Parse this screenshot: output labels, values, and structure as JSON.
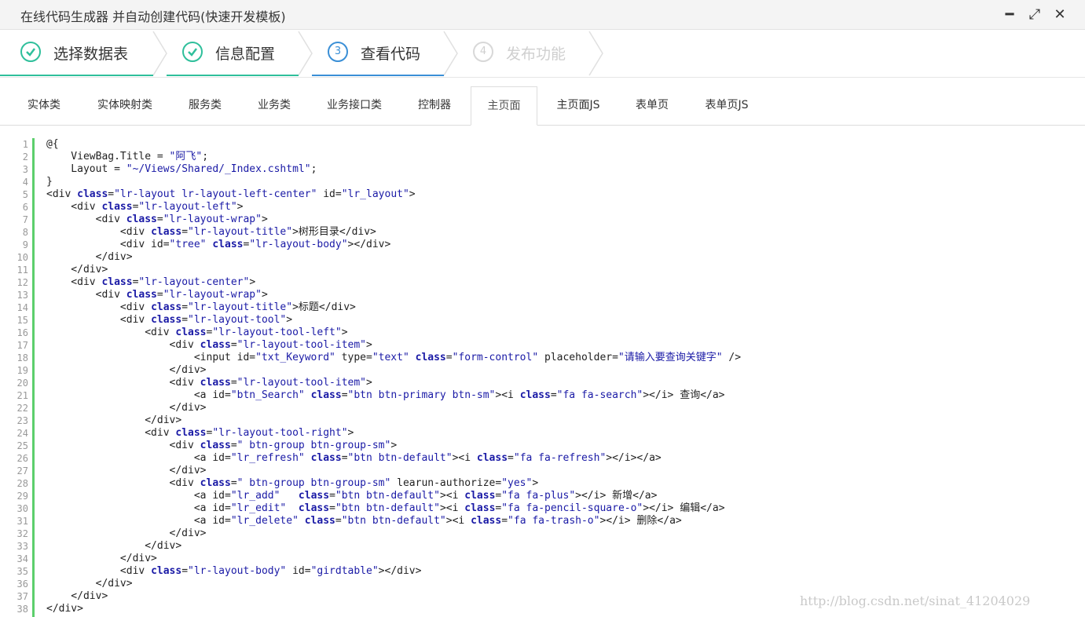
{
  "window": {
    "title": "在线代码生成器 并自动创建代码(快速开发模板)",
    "controls": {
      "minimize": "━",
      "maximize": "⤢",
      "close": "✕"
    }
  },
  "steps": [
    {
      "label": "选择数据表",
      "state": "done",
      "mark": "✓"
    },
    {
      "label": "信息配置",
      "state": "done",
      "mark": "✓"
    },
    {
      "label": "查看代码",
      "state": "current",
      "mark": "3"
    },
    {
      "label": "发布功能",
      "state": "future",
      "mark": "4"
    }
  ],
  "tabs": [
    {
      "label": "实体类"
    },
    {
      "label": "实体映射类"
    },
    {
      "label": "服务类"
    },
    {
      "label": "业务类"
    },
    {
      "label": "业务接口类"
    },
    {
      "label": "控制器"
    },
    {
      "label": "主页面",
      "active": true
    },
    {
      "label": "主页面JS"
    },
    {
      "label": "表单页"
    },
    {
      "label": "表单页JS"
    }
  ],
  "colors": {
    "kw": "#1a1aa6",
    "str": "#1a1aa6",
    "tag": "#222222",
    "success": "#2fbf9b",
    "current": "#3a8fd6",
    "gutterbar": "#5ccf6c"
  },
  "code": [
    [
      [
        "",
        "@{"
      ]
    ],
    [
      [
        "",
        "    ViewBag.Title = "
      ],
      [
        "s",
        "\"阿飞\""
      ],
      [
        "",
        ";"
      ]
    ],
    [
      [
        "",
        "    Layout = "
      ],
      [
        "s",
        "\"~/Views/Shared/_Index.cshtml\""
      ],
      [
        "",
        ";"
      ]
    ],
    [
      [
        "",
        "}"
      ]
    ],
    [
      [
        "",
        "<div "
      ],
      [
        "k",
        "class"
      ],
      [
        "",
        "="
      ],
      [
        "s",
        "\"lr-layout lr-layout-left-center\""
      ],
      [
        "",
        " id="
      ],
      [
        "s",
        "\"lr_layout\""
      ],
      [
        "",
        ">"
      ]
    ],
    [
      [
        "",
        "    <div "
      ],
      [
        "k",
        "class"
      ],
      [
        "",
        "="
      ],
      [
        "s",
        "\"lr-layout-left\""
      ],
      [
        "",
        ">"
      ]
    ],
    [
      [
        "",
        "        <div "
      ],
      [
        "k",
        "class"
      ],
      [
        "",
        "="
      ],
      [
        "s",
        "\"lr-layout-wrap\""
      ],
      [
        "",
        ">"
      ]
    ],
    [
      [
        "",
        "            <div "
      ],
      [
        "k",
        "class"
      ],
      [
        "",
        "="
      ],
      [
        "s",
        "\"lr-layout-title\""
      ],
      [
        "",
        ">树形目录</div>"
      ]
    ],
    [
      [
        "",
        "            <div id="
      ],
      [
        "s",
        "\"tree\""
      ],
      [
        "",
        " "
      ],
      [
        "k",
        "class"
      ],
      [
        "",
        "="
      ],
      [
        "s",
        "\"lr-layout-body\""
      ],
      [
        "",
        "></div>"
      ]
    ],
    [
      [
        "",
        "        </div>"
      ]
    ],
    [
      [
        "",
        "    </div>"
      ]
    ],
    [
      [
        "",
        "    <div "
      ],
      [
        "k",
        "class"
      ],
      [
        "",
        "="
      ],
      [
        "s",
        "\"lr-layout-center\""
      ],
      [
        "",
        ">"
      ]
    ],
    [
      [
        "",
        "        <div "
      ],
      [
        "k",
        "class"
      ],
      [
        "",
        "="
      ],
      [
        "s",
        "\"lr-layout-wrap\""
      ],
      [
        "",
        ">"
      ]
    ],
    [
      [
        "",
        "            <div "
      ],
      [
        "k",
        "class"
      ],
      [
        "",
        "="
      ],
      [
        "s",
        "\"lr-layout-title\""
      ],
      [
        "",
        ">标题</div>"
      ]
    ],
    [
      [
        "",
        "            <div "
      ],
      [
        "k",
        "class"
      ],
      [
        "",
        "="
      ],
      [
        "s",
        "\"lr-layout-tool\""
      ],
      [
        "",
        ">"
      ]
    ],
    [
      [
        "",
        "                <div "
      ],
      [
        "k",
        "class"
      ],
      [
        "",
        "="
      ],
      [
        "s",
        "\"lr-layout-tool-left\""
      ],
      [
        "",
        ">"
      ]
    ],
    [
      [
        "",
        "                    <div "
      ],
      [
        "k",
        "class"
      ],
      [
        "",
        "="
      ],
      [
        "s",
        "\"lr-layout-tool-item\""
      ],
      [
        "",
        ">"
      ]
    ],
    [
      [
        "",
        "                        <input id="
      ],
      [
        "s",
        "\"txt_Keyword\""
      ],
      [
        "",
        " type="
      ],
      [
        "s",
        "\"text\""
      ],
      [
        "",
        " "
      ],
      [
        "k",
        "class"
      ],
      [
        "",
        "="
      ],
      [
        "s",
        "\"form-control\""
      ],
      [
        "",
        " placeholder="
      ],
      [
        "s",
        "\"请输入要查询关键字\""
      ],
      [
        "",
        " />"
      ]
    ],
    [
      [
        "",
        "                    </div>"
      ]
    ],
    [
      [
        "",
        "                    <div "
      ],
      [
        "k",
        "class"
      ],
      [
        "",
        "="
      ],
      [
        "s",
        "\"lr-layout-tool-item\""
      ],
      [
        "",
        ">"
      ]
    ],
    [
      [
        "",
        "                        <a id="
      ],
      [
        "s",
        "\"btn_Search\""
      ],
      [
        "",
        " "
      ],
      [
        "k",
        "class"
      ],
      [
        "",
        "="
      ],
      [
        "s",
        "\"btn btn-primary btn-sm\""
      ],
      [
        "",
        "><i "
      ],
      [
        "k",
        "class"
      ],
      [
        "",
        "="
      ],
      [
        "s",
        "\"fa fa-search\""
      ],
      [
        "",
        "></i> 查询</a>"
      ]
    ],
    [
      [
        "",
        "                    </div>"
      ]
    ],
    [
      [
        "",
        "                </div>"
      ]
    ],
    [
      [
        "",
        "                <div "
      ],
      [
        "k",
        "class"
      ],
      [
        "",
        "="
      ],
      [
        "s",
        "\"lr-layout-tool-right\""
      ],
      [
        "",
        ">"
      ]
    ],
    [
      [
        "",
        "                    <div "
      ],
      [
        "k",
        "class"
      ],
      [
        "",
        "="
      ],
      [
        "s",
        "\" btn-group btn-group-sm\""
      ],
      [
        "",
        ">"
      ]
    ],
    [
      [
        "",
        "                        <a id="
      ],
      [
        "s",
        "\"lr_refresh\""
      ],
      [
        "",
        " "
      ],
      [
        "k",
        "class"
      ],
      [
        "",
        "="
      ],
      [
        "s",
        "\"btn btn-default\""
      ],
      [
        "",
        "><i "
      ],
      [
        "k",
        "class"
      ],
      [
        "",
        "="
      ],
      [
        "s",
        "\"fa fa-refresh\""
      ],
      [
        "",
        "></i></a>"
      ]
    ],
    [
      [
        "",
        "                    </div>"
      ]
    ],
    [
      [
        "",
        "                    <div "
      ],
      [
        "k",
        "class"
      ],
      [
        "",
        "="
      ],
      [
        "s",
        "\" btn-group btn-group-sm\""
      ],
      [
        "",
        " learun-authorize="
      ],
      [
        "s",
        "\"yes\""
      ],
      [
        "",
        ">"
      ]
    ],
    [
      [
        "",
        "                        <a id="
      ],
      [
        "s",
        "\"lr_add\""
      ],
      [
        "",
        "   "
      ],
      [
        "k",
        "class"
      ],
      [
        "",
        "="
      ],
      [
        "s",
        "\"btn btn-default\""
      ],
      [
        "",
        "><i "
      ],
      [
        "k",
        "class"
      ],
      [
        "",
        "="
      ],
      [
        "s",
        "\"fa fa-plus\""
      ],
      [
        "",
        "></i> 新增</a>"
      ]
    ],
    [
      [
        "",
        "                        <a id="
      ],
      [
        "s",
        "\"lr_edit\""
      ],
      [
        "",
        "  "
      ],
      [
        "k",
        "class"
      ],
      [
        "",
        "="
      ],
      [
        "s",
        "\"btn btn-default\""
      ],
      [
        "",
        "><i "
      ],
      [
        "k",
        "class"
      ],
      [
        "",
        "="
      ],
      [
        "s",
        "\"fa fa-pencil-square-o\""
      ],
      [
        "",
        "></i> 编辑</a>"
      ]
    ],
    [
      [
        "",
        "                        <a id="
      ],
      [
        "s",
        "\"lr_delete\""
      ],
      [
        "",
        " "
      ],
      [
        "k",
        "class"
      ],
      [
        "",
        "="
      ],
      [
        "s",
        "\"btn btn-default\""
      ],
      [
        "",
        "><i "
      ],
      [
        "k",
        "class"
      ],
      [
        "",
        "="
      ],
      [
        "s",
        "\"fa fa-trash-o\""
      ],
      [
        "",
        "></i> 删除</a>"
      ]
    ],
    [
      [
        "",
        "                    </div>"
      ]
    ],
    [
      [
        "",
        "                </div>"
      ]
    ],
    [
      [
        "",
        "            </div>"
      ]
    ],
    [
      [
        "",
        "            <div "
      ],
      [
        "k",
        "class"
      ],
      [
        "",
        "="
      ],
      [
        "s",
        "\"lr-layout-body\""
      ],
      [
        "",
        " id="
      ],
      [
        "s",
        "\"girdtable\""
      ],
      [
        "",
        "></div>"
      ]
    ],
    [
      [
        "",
        "        </div>"
      ]
    ],
    [
      [
        "",
        "    </div>"
      ]
    ],
    [
      [
        "",
        "</div>"
      ]
    ]
  ],
  "watermark": "http://blog.csdn.net/sinat_41204029"
}
